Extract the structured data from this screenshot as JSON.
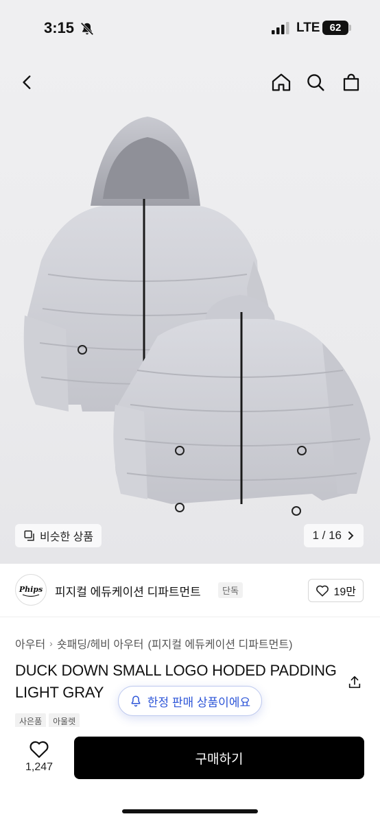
{
  "status": {
    "time": "3:15",
    "network": "LTE",
    "battery": "62"
  },
  "gallery": {
    "similar_label": "비슷한 상품",
    "counter": "1 / 16"
  },
  "brand": {
    "logo_text": "Phips",
    "name": "피지컬 에듀케이션 디파트먼트",
    "tag": "단독",
    "likes": "19만"
  },
  "breadcrumb": {
    "items": [
      "아우터",
      "숏패딩/헤비 아우터"
    ],
    "suffix": "(피지컬 에듀케이션 디파트먼트)"
  },
  "product": {
    "title": "DUCK DOWN SMALL LOGO HODED PADDING LIGHT GRAY",
    "tags": [
      "사은품",
      "아울렛"
    ]
  },
  "toast": {
    "text": "한정 판매 상품이에요"
  },
  "bottom": {
    "like_count": "1,247",
    "buy_label": "구매하기"
  },
  "colors": {
    "accent_blue": "#2d55d8",
    "buy_button": "#000000",
    "jacket": "#cfd0d6"
  },
  "icons": [
    "bell-off-icon",
    "signal-icon",
    "back-icon",
    "home-icon",
    "search-icon",
    "bag-icon",
    "copy-icon",
    "chevron-right-icon",
    "heart-icon",
    "share-icon",
    "bell-icon"
  ]
}
